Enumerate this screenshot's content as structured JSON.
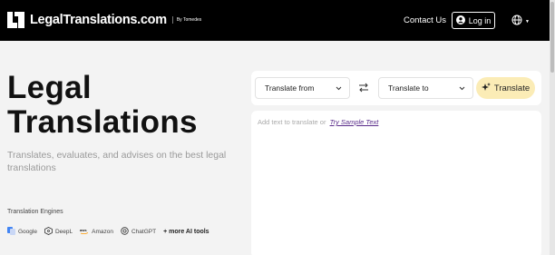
{
  "header": {
    "logo_text": "LegalTranslations.com",
    "logo_sub": "By Tomedes",
    "contact_label": "Contact Us",
    "login_label": "Log in"
  },
  "hero": {
    "title_line1": "Legal",
    "title_line2": "Translations",
    "subtitle": "Translates, evaluates, and advises on the best legal translations"
  },
  "engines": {
    "label": "Translation Engines",
    "items": [
      {
        "name": "Google",
        "icon": "google-translate-icon"
      },
      {
        "name": "DeepL",
        "icon": "deepl-icon"
      },
      {
        "name": "Amazon",
        "icon": "aws-icon"
      },
      {
        "name": "ChatGPT",
        "icon": "openai-icon"
      }
    ],
    "more_label": "+ more AI tools"
  },
  "translator": {
    "from_label": "Translate from",
    "to_label": "Translate to",
    "translate_label": "Translate",
    "placeholder": "Add text to translate or",
    "sample_link": "Try Sample Text"
  },
  "colors": {
    "nav_bg": "#000000",
    "translate_btn": "#fbecb6",
    "sample_link": "#5a2d8a"
  }
}
